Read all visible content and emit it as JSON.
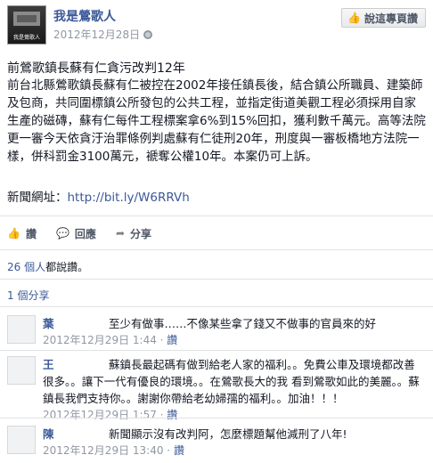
{
  "header": {
    "page_name": "我是鶯歌人",
    "avatar_caption": "我是鶯歌人",
    "timestamp": "2012年12月28日",
    "like_page_label": "說這專頁讚"
  },
  "post": {
    "title": "前鶯歌鎮長蘇有仁貪污改判12年",
    "body": "前台北縣鶯歌鎮長蘇有仁被控在2002年接任鎮長後，結合鎮公所職員、建築師及包商，共同圍標鎮公所發包的公共工程，並指定街道美觀工程必須採用自家生產的磁磚，蘇有仁每件工程標案拿6%到15%回扣，獲利數千萬元。高等法院更一審今天依貪汙治罪條例判處蘇有仁徒刑20年，刑度與一審板橋地方法院一樣，併科罰金3100萬元，褫奪公權10年。本案仍可上訴。",
    "link_label": "新聞網址：",
    "link_url": "http://bit.ly/W6RRVh"
  },
  "actions": {
    "like": "讚",
    "comment": "回應",
    "share": "分享"
  },
  "stats": {
    "likes_count": "26 個人",
    "likes_suffix": "都說讚。",
    "shares": "1 個分享"
  },
  "comments": [
    {
      "author": "葉",
      "text": "至少有做事……不像某些拿了錢又不做事的官員來的好",
      "time": "2012年12月29日 1:44",
      "like": "讚"
    },
    {
      "author": "王",
      "text": "蘇鎮長最起碼有做到給老人家的福利。。免費公車及環境都改善很多。。讓下一代有優良的環境。。在鶯歌長大的我 看到鶯歌如此的美麗。。蘇鎮長我們支持你。。謝謝你帶給老幼婦孺的福利。。加油！！！",
      "time": "2012年12月29日 1:57",
      "like": "讚"
    },
    {
      "author": "陳",
      "text": "新聞顯示沒有改判阿，怎麼標題幫他減刑了八年!",
      "time": "2012年12月29日 13:40",
      "like": "讚"
    }
  ],
  "meta_separator": " · ",
  "icons": {
    "thumb": "thumbs-up-icon",
    "comment": "speech-bubble-icon",
    "share": "share-arrow-icon",
    "globe": "globe-icon"
  }
}
